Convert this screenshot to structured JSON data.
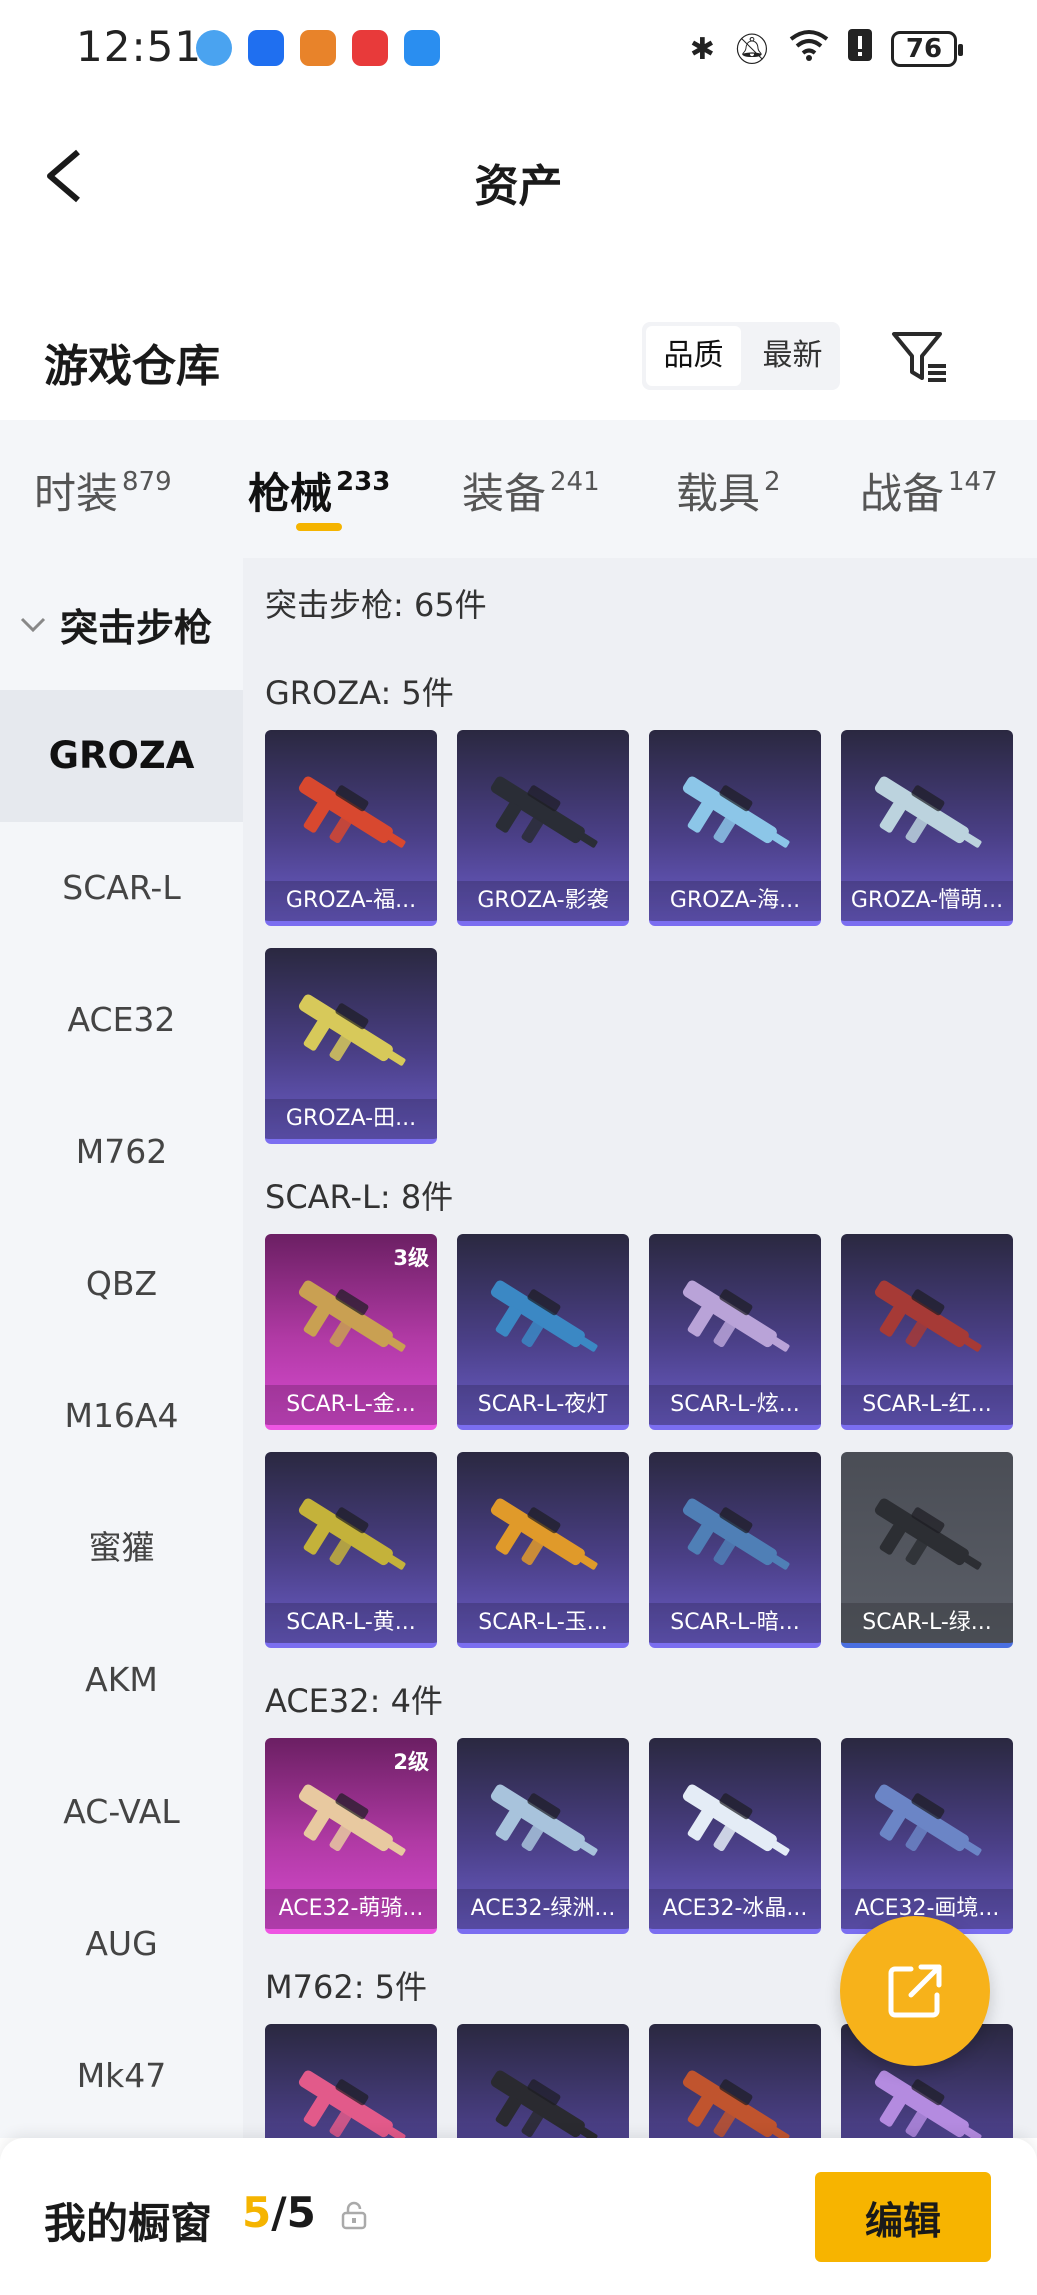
{
  "status_bar": {
    "time": "12:51",
    "battery": "76"
  },
  "nav": {
    "title": "资产"
  },
  "warehouse": {
    "title": "游戏仓库",
    "sort_options": [
      "品质",
      "最新"
    ],
    "sort_active": "品质"
  },
  "tabs": [
    {
      "label": "时装",
      "count": "879"
    },
    {
      "label": "枪械",
      "count": "233"
    },
    {
      "label": "装备",
      "count": "241"
    },
    {
      "label": "载具",
      "count": "2"
    },
    {
      "label": "战备",
      "count": "147"
    }
  ],
  "sidebar": {
    "category": "突击步枪",
    "items": [
      "GROZA",
      "SCAR-L",
      "ACE32",
      "M762",
      "QBZ",
      "M16A4",
      "蜜獾",
      "AKM",
      "AC-VAL",
      "AUG",
      "Mk47"
    ]
  },
  "content": {
    "section_count": "突击步枪: 65件",
    "groups": [
      {
        "title": "GROZA: 5件",
        "items": [
          {
            "label": "GROZA-福...",
            "tier": "purple",
            "gun": "#d8482f"
          },
          {
            "label": "GROZA-影袭",
            "tier": "purple",
            "gun": "#2a2d36"
          },
          {
            "label": "GROZA-海...",
            "tier": "purple",
            "gun": "#8cc6e8"
          },
          {
            "label": "GROZA-懵萌...",
            "tier": "purple",
            "gun": "#bcd3de"
          },
          {
            "label": "GROZA-田...",
            "tier": "purple",
            "gun": "#d7c95a"
          }
        ]
      },
      {
        "title": "SCAR-L: 8件",
        "items": [
          {
            "label": "SCAR-L-金...",
            "tier": "pink",
            "level": "3级",
            "gun": "#c9a052"
          },
          {
            "label": "SCAR-L-夜灯",
            "tier": "purple",
            "gun": "#3b88c4"
          },
          {
            "label": "SCAR-L-炫...",
            "tier": "purple",
            "gun": "#b9a3d8"
          },
          {
            "label": "SCAR-L-红...",
            "tier": "purple",
            "gun": "#a63a36"
          },
          {
            "label": "SCAR-L-黄...",
            "tier": "purple",
            "gun": "#c4b23a"
          },
          {
            "label": "SCAR-L-玉...",
            "tier": "purple",
            "gun": "#e09a2a"
          },
          {
            "label": "SCAR-L-暗...",
            "tier": "purple",
            "gun": "#4f7fb6"
          },
          {
            "label": "SCAR-L-绿...",
            "tier": "gray",
            "gun": "#2c2e33"
          }
        ]
      },
      {
        "title": "ACE32: 4件",
        "items": [
          {
            "label": "ACE32-萌骑...",
            "tier": "pink",
            "level": "2级",
            "gun": "#e8c9a0"
          },
          {
            "label": "ACE32-绿洲...",
            "tier": "purple",
            "gun": "#a8c3dc"
          },
          {
            "label": "ACE32-冰晶...",
            "tier": "purple",
            "gun": "#e4ecf6"
          },
          {
            "label": "ACE32-画境...",
            "tier": "purple",
            "gun": "#6b85c6"
          }
        ]
      },
      {
        "title": "M762: 5件",
        "items": [
          {
            "label": "",
            "tier": "purple",
            "gun": "#e25a8a"
          },
          {
            "label": "",
            "tier": "purple",
            "gun": "#2a2a30"
          },
          {
            "label": "",
            "tier": "purple",
            "gun": "#c0542e"
          },
          {
            "label": "",
            "tier": "purple",
            "gun": "#b48be0"
          }
        ]
      }
    ]
  },
  "bottom_bar": {
    "title": "我的橱窗",
    "current": "5",
    "total": "/5",
    "edit_label": "编辑"
  },
  "colors": {
    "accent": "#f5b400",
    "purple_tier": "#6a5cc6",
    "pink_tier": "#d64ad0"
  }
}
